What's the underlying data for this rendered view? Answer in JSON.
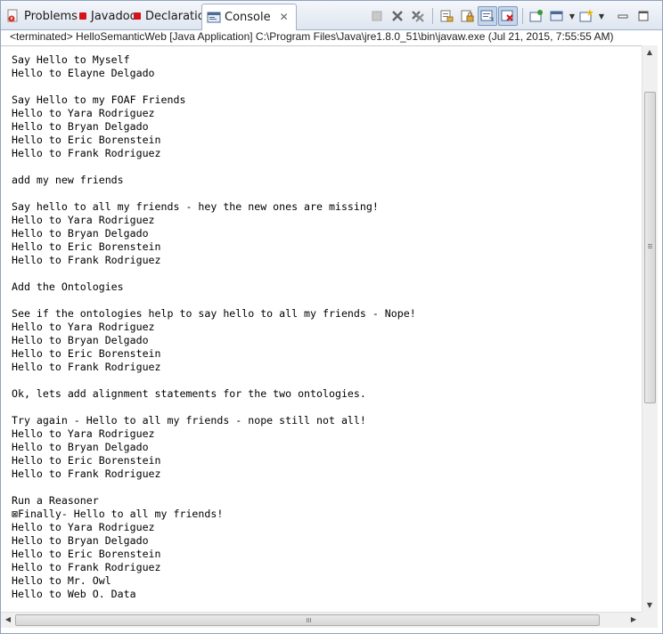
{
  "tabs": [
    {
      "label": "Problems"
    },
    {
      "label": "Javadoc"
    },
    {
      "label": "Declaration"
    },
    {
      "label": "Console"
    }
  ],
  "toolbar": {
    "icons": [
      "terminate-icon",
      "remove-launch-icon",
      "remove-all-terminated-icon",
      "clear-console-icon",
      "scroll-lock-icon",
      "word-wrap-icon",
      "show-on-stdout-icon",
      "show-on-stderr-icon",
      "pin-console-icon",
      "display-console-icon",
      "open-console-icon",
      "minimize-icon",
      "maximize-icon"
    ]
  },
  "status": "<terminated> HelloSemanticWeb [Java Application] C:\\Program Files\\Java\\jre1.8.0_51\\bin\\javaw.exe (Jul 21, 2015, 7:55:55 AM)",
  "console_lines": [
    "Say Hello to Myself",
    "Hello to Elayne Delgado",
    "",
    "Say Hello to my FOAF Friends",
    "Hello to Yara Rodriguez",
    "Hello to Bryan Delgado",
    "Hello to Eric Borenstein",
    "Hello to Frank Rodriguez",
    "",
    "add my new friends",
    "",
    "Say hello to all my friends - hey the new ones are missing!",
    "Hello to Yara Rodriguez",
    "Hello to Bryan Delgado",
    "Hello to Eric Borenstein",
    "Hello to Frank Rodriguez",
    "",
    "Add the Ontologies",
    "",
    "See if the ontologies help to say hello to all my friends - Nope!",
    "Hello to Yara Rodriguez",
    "Hello to Bryan Delgado",
    "Hello to Eric Borenstein",
    "Hello to Frank Rodriguez",
    "",
    "Ok, lets add alignment statements for the two ontologies.",
    "",
    "Try again - Hello to all my friends - nope still not all!",
    "Hello to Yara Rodriguez",
    "Hello to Bryan Delgado",
    "Hello to Eric Borenstein",
    "Hello to Frank Rodriguez",
    "",
    "Run a Reasoner",
    "⊠Finally- Hello to all my friends!",
    "Hello to Yara Rodriguez",
    "Hello to Bryan Delgado",
    "Hello to Eric Borenstein",
    "Hello to Frank Rodriguez",
    "Hello to Mr. Owl",
    "Hello to Web O. Data"
  ],
  "colors": {
    "accent": "#7d99bf",
    "tab_bar": "#dfe6f0",
    "marker_red": "#d4141a"
  }
}
